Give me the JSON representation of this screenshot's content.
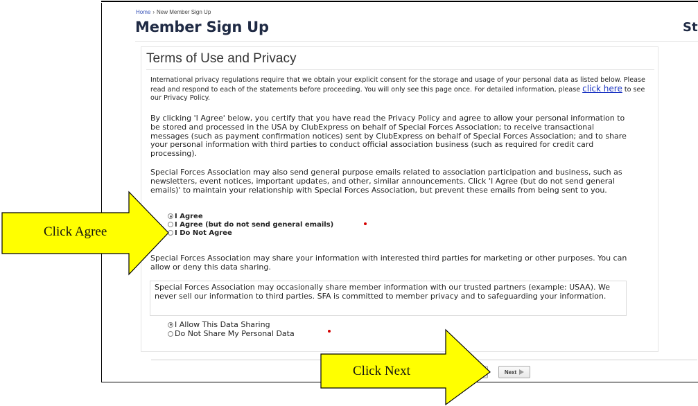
{
  "breadcrumb": {
    "home": "Home",
    "separator": "›",
    "current": "New Member Sign Up"
  },
  "page_title": "Member Sign Up",
  "store_label": "Sto",
  "panel": {
    "title": "Terms of Use and Privacy",
    "intro_before_link": "International privacy regulations require that we obtain your explicit consent for the storage and usage of your personal data as listed below. Please read and respond to each of the statements before proceeding. You will only see this page once. For detailed information, please ",
    "intro_link": "click here",
    "intro_after_link": " to see our Privacy Policy.",
    "para_consent": "By clicking 'I Agree' below, you certify that you have read the Privacy Policy and agree to allow your personal information to be stored and processed in the USA by ClubExpress on behalf of Special Forces Association; to receive transactional messages (such as payment confirmation notices) sent by ClubExpress on behalf of Special Forces Association; and to share your personal information with third parties to conduct official association business (such as required for credit card processing).",
    "para_emails": "Special Forces Association may also send general purpose emails related to association participation and business, such as newsletters, event notices, important updates, and other, similar announcements. Click 'I Agree (but do not send general emails)' to maintain your relationship with Special Forces Association, but prevent these emails from being sent to you.",
    "consent_options": [
      {
        "label": "I Agree",
        "checked": true
      },
      {
        "label": "I Agree (but do not send general emails)",
        "checked": false
      },
      {
        "label": "I Do Not Agree",
        "checked": false
      }
    ],
    "para_sharing": "Special Forces Association may share your information with interested third parties for marketing or other purposes. You can allow or deny this data sharing.",
    "notice": "Special Forces Association may occasionally share member information with our trusted partners (example: USAA). We never sell our information to third parties. SFA is committed to member privacy and to safeguarding your information.",
    "sharing_options": [
      {
        "label": "I Allow This Data Sharing",
        "checked": true
      },
      {
        "label": "Do Not Share My Personal Data",
        "checked": false
      }
    ]
  },
  "buttons": {
    "next": "Next"
  },
  "callouts": {
    "agree": "Click Agree",
    "next": "Click Next"
  },
  "colors": {
    "callout_fill": "#ffff00",
    "link": "#1a33c2",
    "required": "#d40000"
  }
}
